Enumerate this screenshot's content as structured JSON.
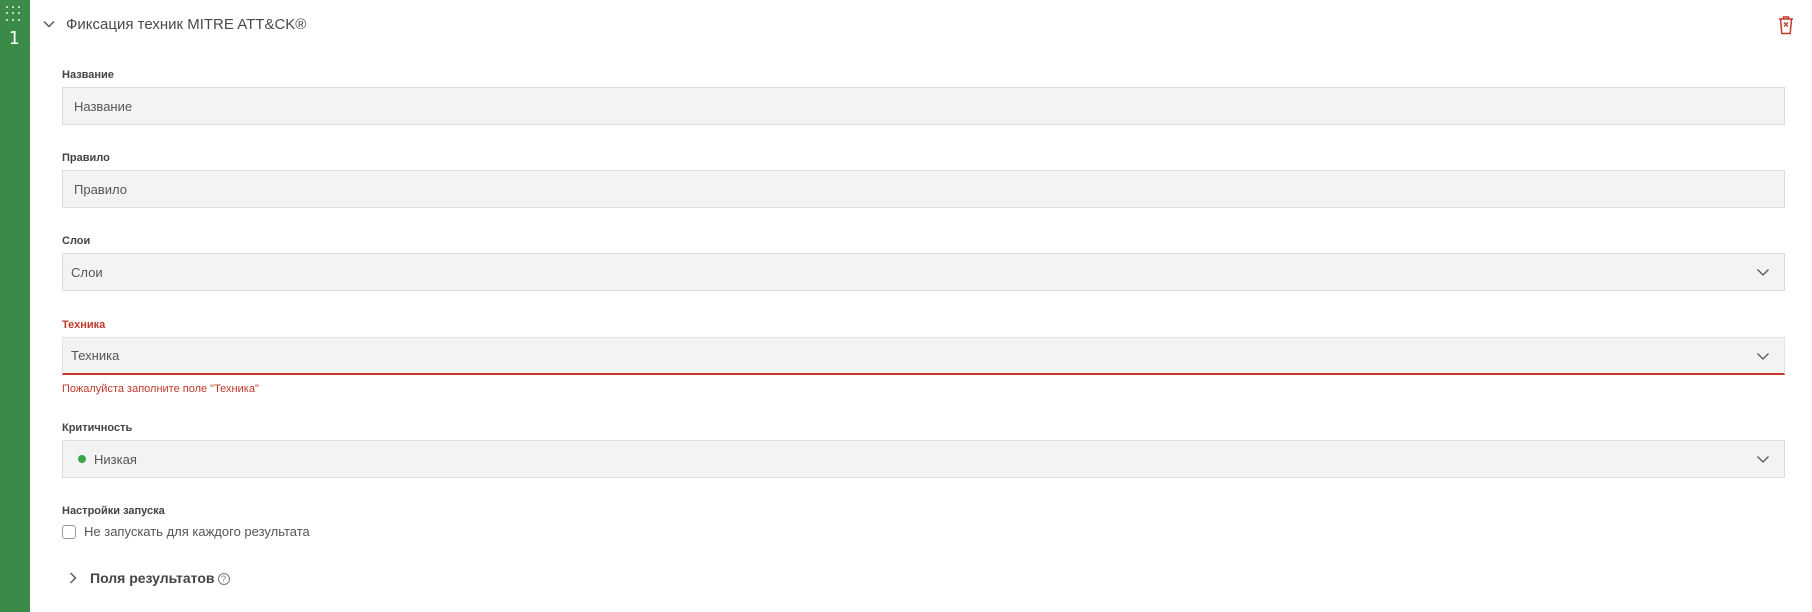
{
  "step": {
    "number": "1"
  },
  "card": {
    "title": "Фиксация техник MITRE ATT&CK®"
  },
  "fields": {
    "name": {
      "label": "Название",
      "placeholder": "Название"
    },
    "rule": {
      "label": "Правило",
      "placeholder": "Правило"
    },
    "layers": {
      "label": "Слои",
      "placeholder": "Слои"
    },
    "technique": {
      "label": "Техника",
      "placeholder": "Техника",
      "error": "Пожалуйста заполните поле \"Техника\""
    },
    "criticality": {
      "label": "Критичность",
      "value": "Низкая",
      "status_color": "#3aa54b"
    }
  },
  "launch_settings": {
    "label": "Настройки запуска",
    "checkbox_label": "Не запускать для каждого результата",
    "checked": false
  },
  "results_section": {
    "label": "Поля результатов"
  },
  "colors": {
    "accent": "#3b8a48",
    "error": "#c0392b",
    "delete": "#c0392b"
  },
  "icons": {
    "grip": "drag-grip-icon",
    "collapse": "chevron-down-icon",
    "delete": "trash-icon",
    "expand": "chevron-right-icon",
    "help": "question-circle-icon"
  }
}
